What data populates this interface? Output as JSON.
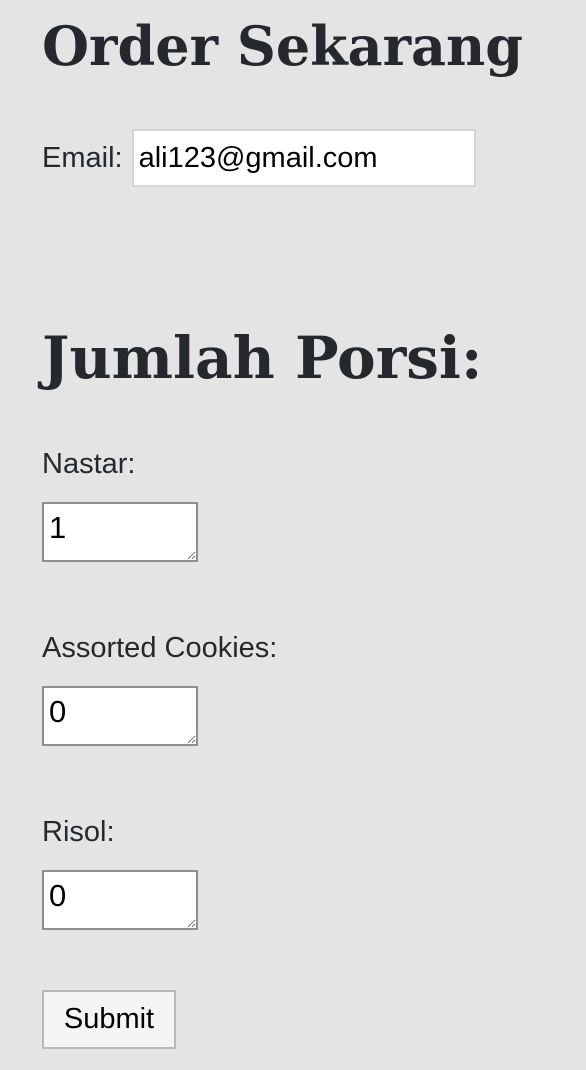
{
  "order_heading": "Order Sekarang",
  "email": {
    "label": "Email:",
    "value": "ali123@gmail.com"
  },
  "portions_heading": "Jumlah Porsi:",
  "items": [
    {
      "label": "Nastar:",
      "value": "1"
    },
    {
      "label": "Assorted Cookies:",
      "value": "0"
    },
    {
      "label": "Risol:",
      "value": "0"
    }
  ],
  "submit_label": "Submit"
}
